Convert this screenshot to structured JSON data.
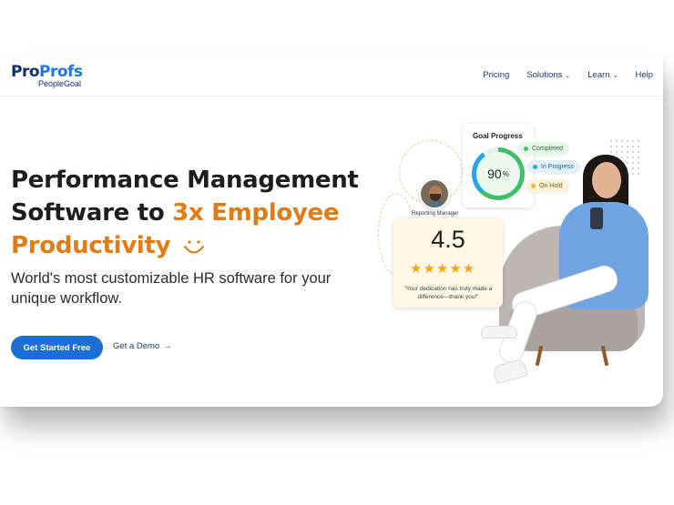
{
  "logo": {
    "brand_part1": "Pro",
    "brand_part2": "Profs",
    "product": "PeopleGoal"
  },
  "nav": {
    "items": [
      {
        "label": "Pricing",
        "has_dropdown": false
      },
      {
        "label": "Solutions",
        "has_dropdown": true
      },
      {
        "label": "Learn",
        "has_dropdown": true
      },
      {
        "label": "Help",
        "has_dropdown": false
      }
    ]
  },
  "hero": {
    "title_line1": "Performance Management",
    "title_line2_a": "Software to ",
    "title_line2_b": "3x Employee",
    "title_line3": "Productivity",
    "description": "World's most customizable HR software for your unique workflow.",
    "cta_primary": "Get Started Free",
    "cta_secondary": "Get a Demo",
    "arrow_glyph": "→",
    "accent_color": "#e07b16",
    "button_color": "#1b6ed6"
  },
  "goal_card": {
    "title": "Goal Progress",
    "value": "90",
    "unit": "%",
    "statuses": [
      {
        "label": "Completed",
        "color": "#3fbf6a"
      },
      {
        "label": "In Progress",
        "color": "#2aa6e8"
      },
      {
        "label": "On Hold",
        "color": "#f2b233"
      }
    ]
  },
  "rating_card": {
    "manager_label": "Reporting Manager",
    "score": "4.5",
    "stars_glyph": "★★★★★",
    "stars_value": 4.5,
    "stars_max": 5,
    "quote": "\"Your dedication has truly made a difference—thank you!\""
  }
}
